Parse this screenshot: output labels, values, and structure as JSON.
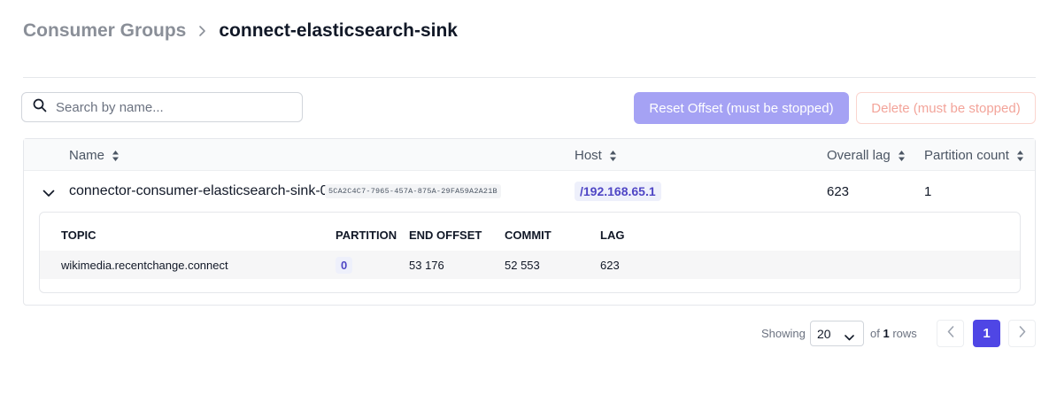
{
  "breadcrumb": {
    "parent": "Consumer Groups",
    "current": "connect-elasticsearch-sink"
  },
  "toolbar": {
    "search_placeholder": "Search by name...",
    "reset_label": "Reset Offset (must be stopped)",
    "delete_label": "Delete (must be stopped)"
  },
  "table": {
    "columns": [
      "Name",
      "Host",
      "Overall lag",
      "Partition count"
    ],
    "rows": [
      {
        "name": "connector-consumer-elasticsearch-sink-0",
        "member_id": "5CA2C4C7-7965-457A-875A-29FA59A2A21B",
        "host": "/192.168.65.1",
        "overall_lag": "623",
        "partition_count": "1",
        "expanded": true,
        "assignments": {
          "columns": [
            "TOPIC",
            "PARTITION",
            "END OFFSET",
            "COMMIT",
            "LAG"
          ],
          "rows": [
            {
              "topic": "wikimedia.recentchange.connect",
              "partition": "0",
              "end_offset": "53 176",
              "commit": "52 553",
              "lag": "623"
            }
          ]
        }
      }
    ]
  },
  "pagination": {
    "showing_label": "Showing",
    "page_size": "20",
    "of_label": "of",
    "total_rows": "1",
    "rows_label": "rows",
    "current_page": "1"
  },
  "colors": {
    "accent": "#4f46e5",
    "reset_button_bg": "#a5a2f4",
    "delete_text": "#f3a49a"
  }
}
